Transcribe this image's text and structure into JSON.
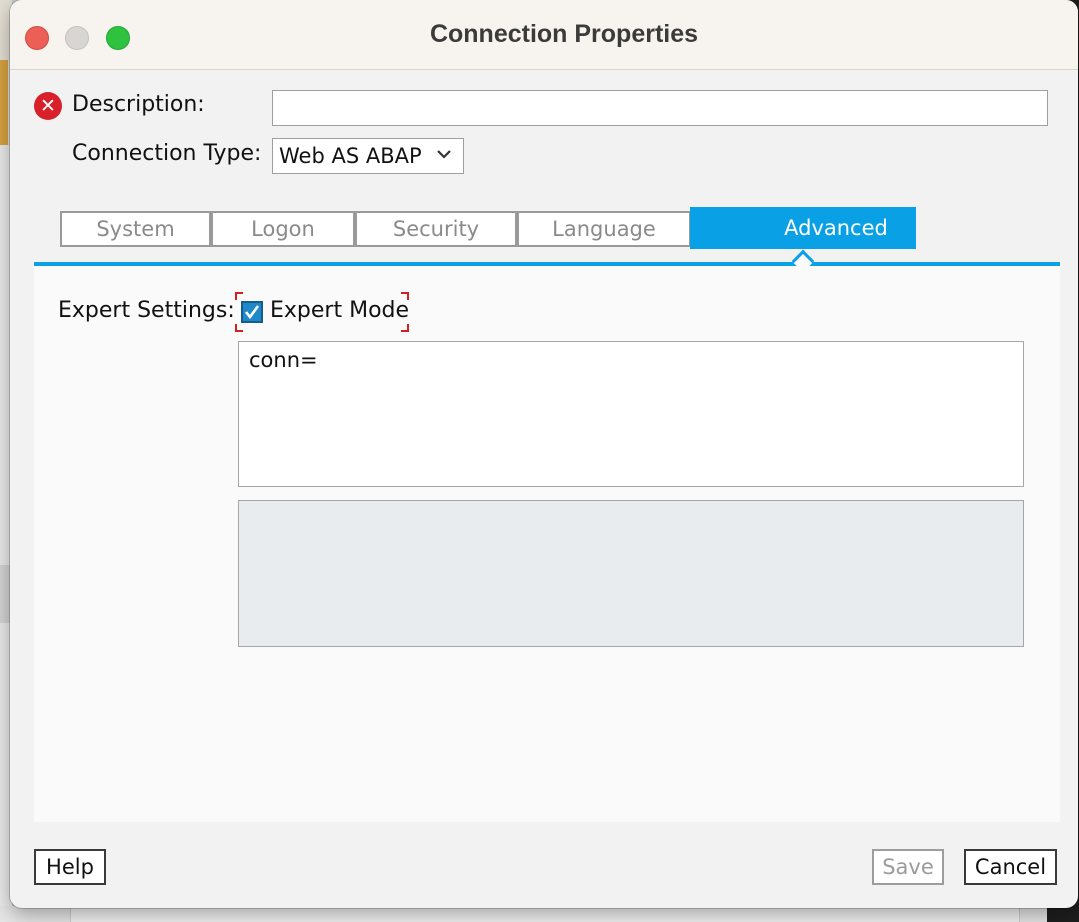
{
  "window": {
    "title": "Connection Properties"
  },
  "form": {
    "description_label": "Description:",
    "description_value": "",
    "connection_type_label": "Connection Type:",
    "connection_type_value": "Web AS ABAP"
  },
  "tabs": [
    {
      "label": "System"
    },
    {
      "label": "Logon"
    },
    {
      "label": "Security"
    },
    {
      "label": "Language"
    },
    {
      "label": "Advanced",
      "active": true
    }
  ],
  "advanced": {
    "expert_settings_label": "Expert Settings:",
    "expert_mode_label": "Expert Mode",
    "expert_mode_checked": true,
    "config_text": "conn="
  },
  "footer": {
    "help_label": "Help",
    "save_label": "Save",
    "cancel_label": "Cancel"
  },
  "colors": {
    "accent": "#0aa0e6",
    "error": "#d8202b",
    "close_button": "#ec5f57",
    "maximize_button": "#2fc23f"
  },
  "icons": {
    "error": "error-circle-x-icon",
    "dropdown": "chevron-down-icon",
    "checkbox": "checkmark-icon"
  }
}
